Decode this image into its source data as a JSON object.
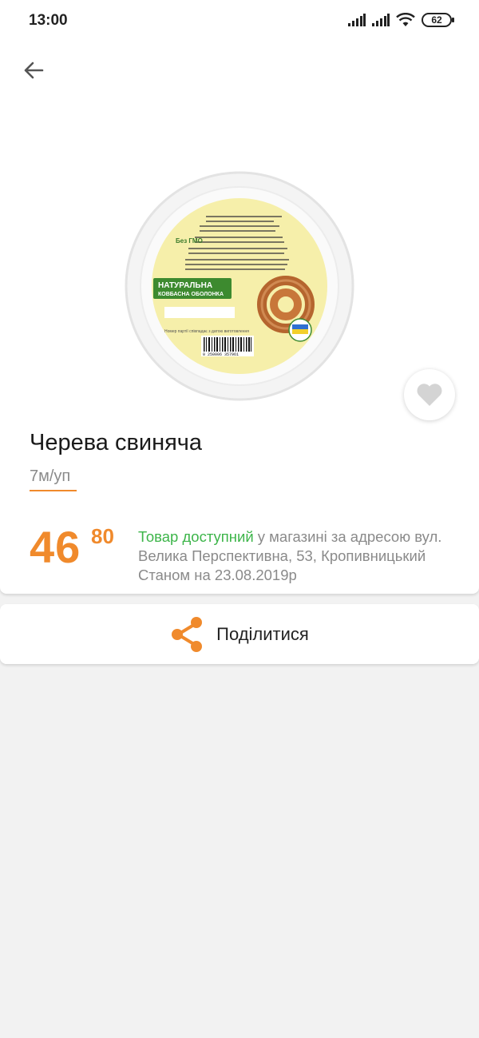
{
  "status_bar": {
    "time": "13:00",
    "battery": "62"
  },
  "header": {
    "back_icon": "arrow-left-icon"
  },
  "product": {
    "title": "Черева свиняча",
    "unit": "7м/уп",
    "price_int": "46",
    "price_frac": "80",
    "availability_highlight": "Товар доступний",
    "availability_rest": " у магазині за адресою вул. Велика Перспективна, 53, Кропивницький",
    "availability_date": "Станом на 23.08.2019р",
    "favorite_icon": "heart-icon"
  },
  "package_label": {
    "brand_line1": "НАТУРАЛЬНА",
    "brand_line2": "КОВБАСНА ОБОЛОНКА",
    "no_gmo": "Без ГМО",
    "barcode": "0 250006 357961",
    "batch_note": "Номер партії співпадає з датою виготовлення"
  },
  "share": {
    "label": "Поділитися",
    "icon": "share-icon"
  },
  "colors": {
    "accent": "#f08a2c",
    "available": "#3db54a",
    "muted": "#8a8a8a",
    "background": "#f2f2f2"
  }
}
